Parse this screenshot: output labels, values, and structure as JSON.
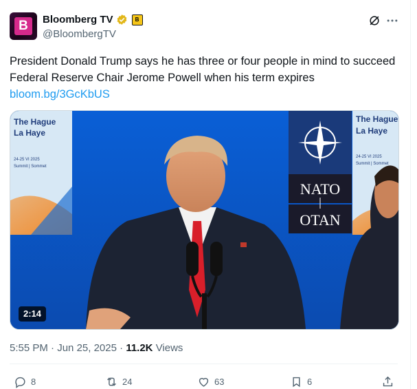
{
  "author": {
    "display_name": "Bloomberg TV",
    "handle": "@BloombergTV",
    "avatar_letter": "B",
    "affiliate_letter": "B"
  },
  "tweet": {
    "text": "President Donald Trump says he has three or four people in mind to succeed Federal Reserve Chair Jerome Powell when his term expires",
    "link": "bloom.bg/3GcKbUS"
  },
  "media": {
    "duration": "2:14",
    "sign_left_title1": "The Hague",
    "sign_left_title2": "La Haye",
    "sign_left_dates": "24-25 VI 2025",
    "sign_left_sub": "Summit | Sommet",
    "sign_right_title1": "The Hague",
    "sign_right_title2": "La Haye",
    "sign_right_dates": "24-25 VI 2025",
    "sign_right_sub": "Summit | Sommet",
    "nato_text": "NATO",
    "otan_text": "OTAN"
  },
  "meta": {
    "time": "5:55 PM",
    "date": "Jun 25, 2025",
    "views_count": "11.2K",
    "views_label": "Views"
  },
  "actions": {
    "replies": "8",
    "reposts": "24",
    "likes": "63",
    "bookmarks": "6"
  },
  "colors": {
    "link": "#1d9bf0",
    "muted": "#536471",
    "verified_gold": "#e2b719"
  }
}
